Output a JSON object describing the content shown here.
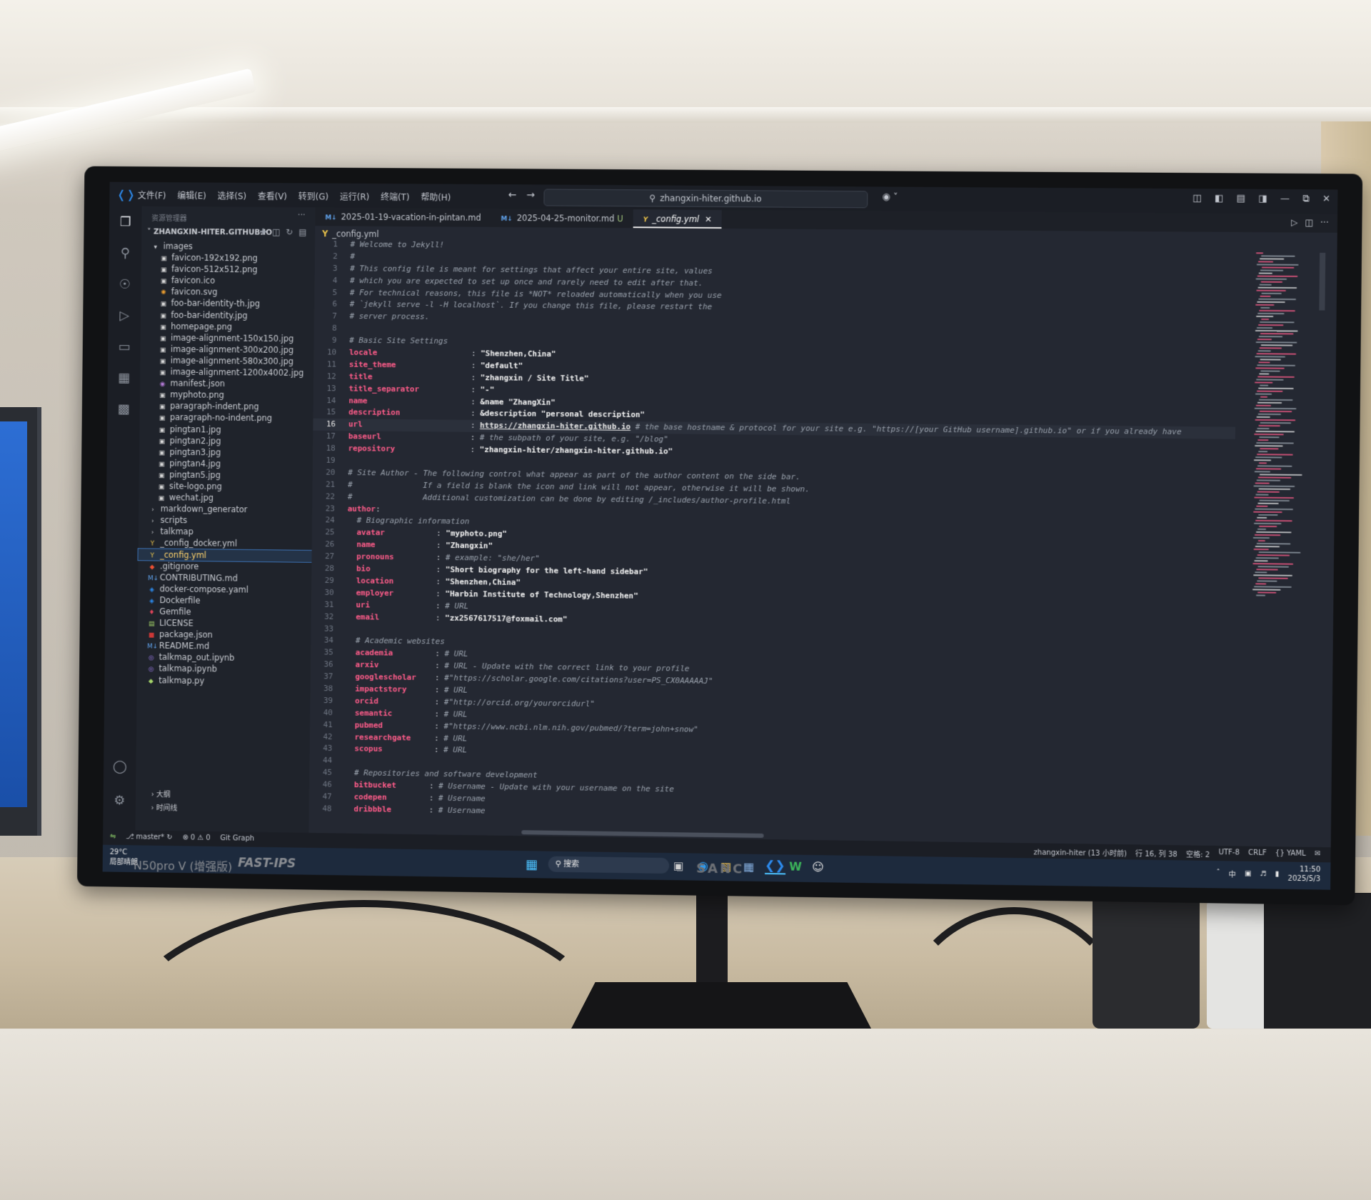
{
  "window": {
    "menu": [
      "文件(F)",
      "编辑(E)",
      "选择(S)",
      "查看(V)",
      "转到(G)",
      "运行(R)",
      "终端(T)",
      "帮助(H)"
    ],
    "search": "zhangxin-hiter.github.io"
  },
  "sidebar": {
    "title": "资源管理器",
    "root": "ZHANGXIN-HITER.GITHUB.IO",
    "folder_images": "images",
    "files": [
      {
        "name": "favicon-192x192.png",
        "icon": "image-icon",
        "color": "#d9d9d9"
      },
      {
        "name": "favicon-512x512.png",
        "icon": "image-icon",
        "color": "#d9d9d9"
      },
      {
        "name": "favicon.ico",
        "icon": "image-icon",
        "color": "#d9d9d9"
      },
      {
        "name": "favicon.svg",
        "icon": "svg-icon",
        "color": "#f0a030"
      },
      {
        "name": "foo-bar-identity-th.jpg",
        "icon": "image-icon",
        "color": "#d9d9d9"
      },
      {
        "name": "foo-bar-identity.jpg",
        "icon": "image-icon",
        "color": "#d9d9d9"
      },
      {
        "name": "homepage.png",
        "icon": "image-icon",
        "color": "#d9d9d9"
      },
      {
        "name": "image-alignment-150x150.jpg",
        "icon": "image-icon",
        "color": "#d9d9d9"
      },
      {
        "name": "image-alignment-300x200.jpg",
        "icon": "image-icon",
        "color": "#d9d9d9"
      },
      {
        "name": "image-alignment-580x300.jpg",
        "icon": "image-icon",
        "color": "#d9d9d9"
      },
      {
        "name": "image-alignment-1200x4002.jpg",
        "icon": "image-icon",
        "color": "#d9d9d9"
      },
      {
        "name": "manifest.json",
        "icon": "json-icon",
        "color": "#b57bd8"
      },
      {
        "name": "myphoto.png",
        "icon": "image-icon",
        "color": "#d9d9d9"
      },
      {
        "name": "paragraph-indent.png",
        "icon": "image-icon",
        "color": "#d9d9d9"
      },
      {
        "name": "paragraph-no-indent.png",
        "icon": "image-icon",
        "color": "#d9d9d9"
      },
      {
        "name": "pingtan1.jpg",
        "icon": "image-icon",
        "color": "#d9d9d9"
      },
      {
        "name": "pingtan2.jpg",
        "icon": "image-icon",
        "color": "#d9d9d9"
      },
      {
        "name": "pingtan3.jpg",
        "icon": "image-icon",
        "color": "#d9d9d9"
      },
      {
        "name": "pingtan4.jpg",
        "icon": "image-icon",
        "color": "#d9d9d9"
      },
      {
        "name": "pingtan5.jpg",
        "icon": "image-icon",
        "color": "#d9d9d9"
      },
      {
        "name": "site-logo.png",
        "icon": "image-icon",
        "color": "#d9d9d9"
      },
      {
        "name": "wechat.jpg",
        "icon": "image-icon",
        "color": "#d9d9d9"
      }
    ],
    "top_items": [
      {
        "name": "markdown_generator",
        "icon": "chevron-right-icon",
        "color": "#c9ccd2"
      },
      {
        "name": "scripts",
        "icon": "chevron-right-icon",
        "color": "#c9ccd2"
      },
      {
        "name": "talkmap",
        "icon": "chevron-right-icon",
        "color": "#c9ccd2"
      },
      {
        "name": "_config_docker.yml",
        "icon": "yaml-icon",
        "color": "#e8c14a"
      },
      {
        "name": "_config.yml",
        "icon": "yaml-icon",
        "color": "#e8c14a"
      },
      {
        "name": ".gitignore",
        "icon": "git-icon",
        "color": "#f05133"
      },
      {
        "name": "CONTRIBUTING.md",
        "icon": "markdown-icon",
        "color": "#5fa0e8"
      },
      {
        "name": "docker-compose.yaml",
        "icon": "docker-icon",
        "color": "#2d8cf0"
      },
      {
        "name": "Dockerfile",
        "icon": "docker-icon",
        "color": "#2d8cf0"
      },
      {
        "name": "Gemfile",
        "icon": "ruby-icon",
        "color": "#e0455b"
      },
      {
        "name": "LICENSE",
        "icon": "license-icon",
        "color": "#a5d46a"
      },
      {
        "name": "package.json",
        "icon": "npm-icon",
        "color": "#cb3837"
      },
      {
        "name": "README.md",
        "icon": "markdown-icon",
        "color": "#5fa0e8"
      },
      {
        "name": "talkmap_out.ipynb",
        "icon": "jupyter-icon",
        "color": "#9b7be8"
      },
      {
        "name": "talkmap.ipynb",
        "icon": "jupyter-icon",
        "color": "#9b7be8"
      },
      {
        "name": "talkmap.py",
        "icon": "python-icon",
        "color": "#a5d46a"
      }
    ],
    "outline": "大纲",
    "timeline": "时间线"
  },
  "tabs": [
    {
      "label": "2025-01-19-vacation-in-pintan.md",
      "icon": "M↓",
      "active": false,
      "modified": ""
    },
    {
      "label": "2025-04-25-monitor.md",
      "icon": "M↓",
      "active": false,
      "modified": "U"
    },
    {
      "label": "_config.yml",
      "icon": "Y",
      "active": true,
      "modified": ""
    }
  ],
  "breadcrumb": "_config.yml",
  "code_lines": [
    {
      "n": "1",
      "parts": [
        [
          "cmt",
          "# Welcome to Jekyll!"
        ]
      ]
    },
    {
      "n": "2",
      "parts": [
        [
          "cmt",
          "#"
        ]
      ]
    },
    {
      "n": "3",
      "parts": [
        [
          "cmt",
          "# This config file is meant for settings that affect your entire site, values"
        ]
      ]
    },
    {
      "n": "4",
      "parts": [
        [
          "cmt",
          "# which you are expected to set up once and rarely need to edit after that."
        ]
      ]
    },
    {
      "n": "5",
      "parts": [
        [
          "cmt",
          "# For technical reasons, this file is *NOT* reloaded automatically when you use"
        ]
      ]
    },
    {
      "n": "6",
      "parts": [
        [
          "cmt",
          "# `jekyll serve -l -H localhost`. If you change this file, please restart the"
        ]
      ]
    },
    {
      "n": "7",
      "parts": [
        [
          "cmt",
          "# server process."
        ]
      ]
    },
    {
      "n": "8",
      "parts": []
    },
    {
      "n": "9",
      "parts": [
        [
          "cmt",
          "# Basic Site Settings"
        ]
      ]
    },
    {
      "n": "10",
      "parts": [
        [
          "key",
          "locale"
        ],
        [
          "plain",
          "                    : "
        ],
        [
          "str",
          "\"Shenzhen,China\""
        ]
      ]
    },
    {
      "n": "11",
      "parts": [
        [
          "key",
          "site_theme"
        ],
        [
          "plain",
          "                : "
        ],
        [
          "str",
          "\"default\""
        ]
      ]
    },
    {
      "n": "12",
      "parts": [
        [
          "key",
          "title"
        ],
        [
          "plain",
          "                     : "
        ],
        [
          "str",
          "\"zhangxin / Site Title\""
        ]
      ]
    },
    {
      "n": "13",
      "parts": [
        [
          "key",
          "title_separator"
        ],
        [
          "plain",
          "           : "
        ],
        [
          "str",
          "\"-\""
        ]
      ]
    },
    {
      "n": "14",
      "parts": [
        [
          "key",
          "name"
        ],
        [
          "plain",
          "                      : "
        ],
        [
          "str",
          "&name \"ZhangXin\""
        ]
      ]
    },
    {
      "n": "15",
      "parts": [
        [
          "key",
          "description"
        ],
        [
          "plain",
          "               : "
        ],
        [
          "str",
          "&description \"personal description\""
        ]
      ]
    },
    {
      "n": "16",
      "cur": true,
      "parts": [
        [
          "key",
          "url"
        ],
        [
          "plain",
          "                       : "
        ],
        [
          "link",
          "https://zhangxin-hiter.github.io"
        ],
        [
          "cmt",
          " # the base hostname & protocol for your site e.g. \"https://[your GitHub username].github.io\" or if you already have"
        ]
      ]
    },
    {
      "n": "17",
      "parts": [
        [
          "key",
          "baseurl"
        ],
        [
          "plain",
          "                   : "
        ],
        [
          "cmt",
          "# the subpath of your site, e.g. \"/blog\""
        ]
      ]
    },
    {
      "n": "18",
      "parts": [
        [
          "key",
          "repository"
        ],
        [
          "plain",
          "                : "
        ],
        [
          "str",
          "\"zhangxin-hiter/zhangxin-hiter.github.io\""
        ]
      ]
    },
    {
      "n": "19",
      "parts": []
    },
    {
      "n": "20",
      "parts": [
        [
          "cmt",
          "# Site Author - The following control what appear as part of the author content on the side bar."
        ]
      ]
    },
    {
      "n": "21",
      "parts": [
        [
          "cmt",
          "#               If a field is blank the icon and link will not appear, otherwise it will be shown."
        ]
      ]
    },
    {
      "n": "22",
      "parts": [
        [
          "cmt",
          "#               Additional customization can be done by editing /_includes/author-profile.html"
        ]
      ]
    },
    {
      "n": "23",
      "parts": [
        [
          "key",
          "author"
        ],
        [
          "plain",
          ":"
        ]
      ]
    },
    {
      "n": "24",
      "parts": [
        [
          "plain",
          "  "
        ],
        [
          "cmt",
          "# Biographic information"
        ]
      ]
    },
    {
      "n": "25",
      "parts": [
        [
          "plain",
          "  "
        ],
        [
          "key",
          "avatar"
        ],
        [
          "plain",
          "           : "
        ],
        [
          "str",
          "\"myphoto.png\""
        ]
      ]
    },
    {
      "n": "26",
      "parts": [
        [
          "plain",
          "  "
        ],
        [
          "key",
          "name"
        ],
        [
          "plain",
          "             : "
        ],
        [
          "str",
          "\"Zhangxin\""
        ]
      ]
    },
    {
      "n": "27",
      "parts": [
        [
          "plain",
          "  "
        ],
        [
          "key",
          "pronouns"
        ],
        [
          "plain",
          "         : "
        ],
        [
          "cmt",
          "# example: \"she/her\""
        ]
      ]
    },
    {
      "n": "28",
      "parts": [
        [
          "plain",
          "  "
        ],
        [
          "key",
          "bio"
        ],
        [
          "plain",
          "              : "
        ],
        [
          "str",
          "\"Short biography for the left-hand sidebar\""
        ]
      ]
    },
    {
      "n": "29",
      "parts": [
        [
          "plain",
          "  "
        ],
        [
          "key",
          "location"
        ],
        [
          "plain",
          "         : "
        ],
        [
          "str",
          "\"Shenzhen,China\""
        ]
      ]
    },
    {
      "n": "30",
      "parts": [
        [
          "plain",
          "  "
        ],
        [
          "key",
          "employer"
        ],
        [
          "plain",
          "         : "
        ],
        [
          "str",
          "\"Harbin Institute of Technology,Shenzhen\""
        ]
      ]
    },
    {
      "n": "31",
      "parts": [
        [
          "plain",
          "  "
        ],
        [
          "key",
          "uri"
        ],
        [
          "plain",
          "              : "
        ],
        [
          "cmt",
          "# URL"
        ]
      ]
    },
    {
      "n": "32",
      "parts": [
        [
          "plain",
          "  "
        ],
        [
          "key",
          "email"
        ],
        [
          "plain",
          "            : "
        ],
        [
          "str",
          "\"zx2567617517@foxmail.com\""
        ]
      ]
    },
    {
      "n": "33",
      "parts": []
    },
    {
      "n": "34",
      "parts": [
        [
          "plain",
          "  "
        ],
        [
          "cmt",
          "# Academic websites"
        ]
      ]
    },
    {
      "n": "35",
      "parts": [
        [
          "plain",
          "  "
        ],
        [
          "key",
          "academia"
        ],
        [
          "plain",
          "         : "
        ],
        [
          "cmt",
          "# URL"
        ]
      ]
    },
    {
      "n": "36",
      "parts": [
        [
          "plain",
          "  "
        ],
        [
          "key",
          "arxiv"
        ],
        [
          "plain",
          "            : "
        ],
        [
          "cmt",
          "# URL - Update with the correct link to your profile"
        ]
      ]
    },
    {
      "n": "37",
      "parts": [
        [
          "plain",
          "  "
        ],
        [
          "key",
          "googlescholar"
        ],
        [
          "plain",
          "    : "
        ],
        [
          "cmt",
          "#\"https://scholar.google.com/citations?user=PS_CX0AAAAAJ\""
        ]
      ]
    },
    {
      "n": "38",
      "parts": [
        [
          "plain",
          "  "
        ],
        [
          "key",
          "impactstory"
        ],
        [
          "plain",
          "      : "
        ],
        [
          "cmt",
          "# URL"
        ]
      ]
    },
    {
      "n": "39",
      "parts": [
        [
          "plain",
          "  "
        ],
        [
          "key",
          "orcid"
        ],
        [
          "plain",
          "            : "
        ],
        [
          "cmt",
          "#\"http://orcid.org/yourorcidurl\""
        ]
      ]
    },
    {
      "n": "40",
      "parts": [
        [
          "plain",
          "  "
        ],
        [
          "key",
          "semantic"
        ],
        [
          "plain",
          "         : "
        ],
        [
          "cmt",
          "# URL"
        ]
      ]
    },
    {
      "n": "41",
      "parts": [
        [
          "plain",
          "  "
        ],
        [
          "key",
          "pubmed"
        ],
        [
          "plain",
          "           : "
        ],
        [
          "cmt",
          "#\"https://www.ncbi.nlm.nih.gov/pubmed/?term=john+snow\""
        ]
      ]
    },
    {
      "n": "42",
      "parts": [
        [
          "plain",
          "  "
        ],
        [
          "key",
          "researchgate"
        ],
        [
          "plain",
          "     : "
        ],
        [
          "cmt",
          "# URL"
        ]
      ]
    },
    {
      "n": "43",
      "parts": [
        [
          "plain",
          "  "
        ],
        [
          "key",
          "scopus"
        ],
        [
          "plain",
          "           : "
        ],
        [
          "cmt",
          "# URL"
        ]
      ]
    },
    {
      "n": "44",
      "parts": []
    },
    {
      "n": "45",
      "parts": [
        [
          "plain",
          "  "
        ],
        [
          "cmt",
          "# Repositories and software development"
        ]
      ]
    },
    {
      "n": "46",
      "parts": [
        [
          "plain",
          "  "
        ],
        [
          "key",
          "bitbucket"
        ],
        [
          "plain",
          "       : "
        ],
        [
          "cmt",
          "# Username - Update with your username on the site"
        ]
      ]
    },
    {
      "n": "47",
      "parts": [
        [
          "plain",
          "  "
        ],
        [
          "key",
          "codepen"
        ],
        [
          "plain",
          "         : "
        ],
        [
          "cmt",
          "# Username"
        ]
      ]
    },
    {
      "n": "48",
      "parts": [
        [
          "plain",
          "  "
        ],
        [
          "key",
          "dribbble"
        ],
        [
          "plain",
          "        : "
        ],
        [
          "cmt",
          "# Username"
        ]
      ]
    }
  ],
  "statusbar": {
    "branch": "master*",
    "problems": "⊗ 0 ⚠ 0",
    "git_graph": "Git Graph",
    "blame": "zhangxin-hiter (13 小时前)",
    "position": "行 16, 列 38",
    "spaces": "空格: 2",
    "encoding": "UTF-8",
    "eol": "CRLF",
    "language": "{} YAML"
  },
  "taskbar": {
    "weather_temp": "29°C",
    "weather_desc": "局部晴朗",
    "search": "搜索",
    "lang": "中",
    "time": "11:50",
    "date": "2025/5/3"
  },
  "monitor": {
    "model": "N50pro V (增强版)",
    "tagline": "FAST-IPS",
    "brand": "SANC"
  },
  "colors": {
    "accent": "#2d8cf0",
    "key": "#ff5c8a",
    "selection": "#ffd36b"
  }
}
